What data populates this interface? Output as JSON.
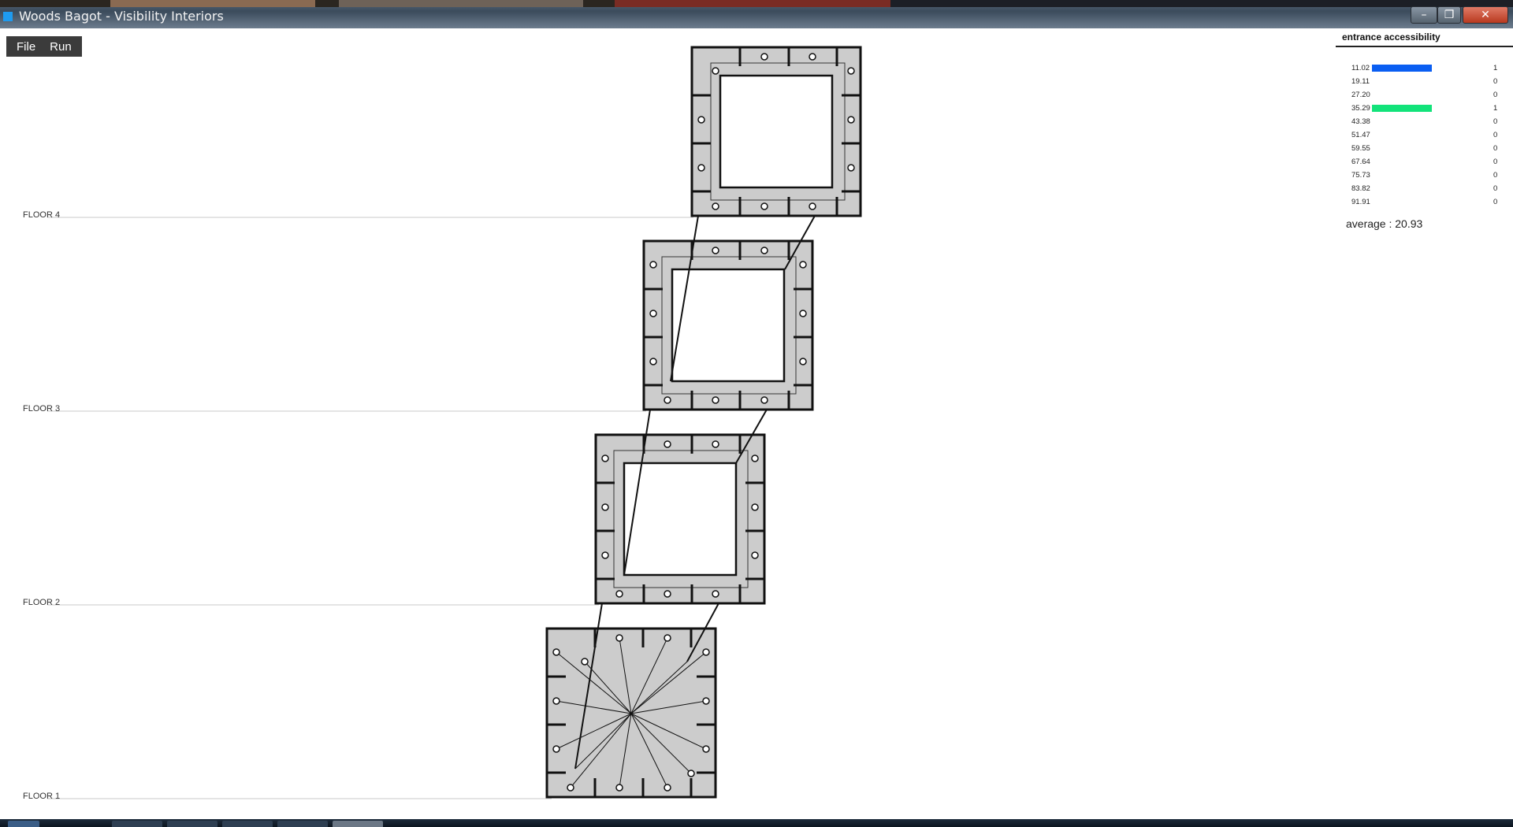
{
  "window": {
    "title": "Woods Bagot - Visibility Interiors",
    "minimize_icon": "minimize-icon",
    "maximize_icon": "restore-icon",
    "close_icon": "close-icon"
  },
  "menu": {
    "items": [
      "File",
      "Run"
    ]
  },
  "floors": [
    "FLOOR 4",
    "FLOOR 3",
    "FLOOR 2",
    "FLOOR 1"
  ],
  "legend": {
    "title": "entrance accessibility",
    "rows": [
      {
        "value": "11.02",
        "count": "1",
        "color": "#0a5ef2"
      },
      {
        "value": "19.11",
        "count": "0",
        "color": ""
      },
      {
        "value": "27.20",
        "count": "0",
        "color": ""
      },
      {
        "value": "35.29",
        "count": "1",
        "color": "#12e37a"
      },
      {
        "value": "43.38",
        "count": "0",
        "color": ""
      },
      {
        "value": "51.47",
        "count": "0",
        "color": ""
      },
      {
        "value": "59.55",
        "count": "0",
        "color": ""
      },
      {
        "value": "67.64",
        "count": "0",
        "color": ""
      },
      {
        "value": "75.73",
        "count": "0",
        "color": ""
      },
      {
        "value": "83.82",
        "count": "0",
        "color": ""
      },
      {
        "value": "91.91",
        "count": "0",
        "color": ""
      }
    ],
    "average": "average : 20.93"
  },
  "colors": {
    "floor_fill": "#cccccc",
    "outline": "#111111",
    "menubar": "#3b3b3b"
  }
}
